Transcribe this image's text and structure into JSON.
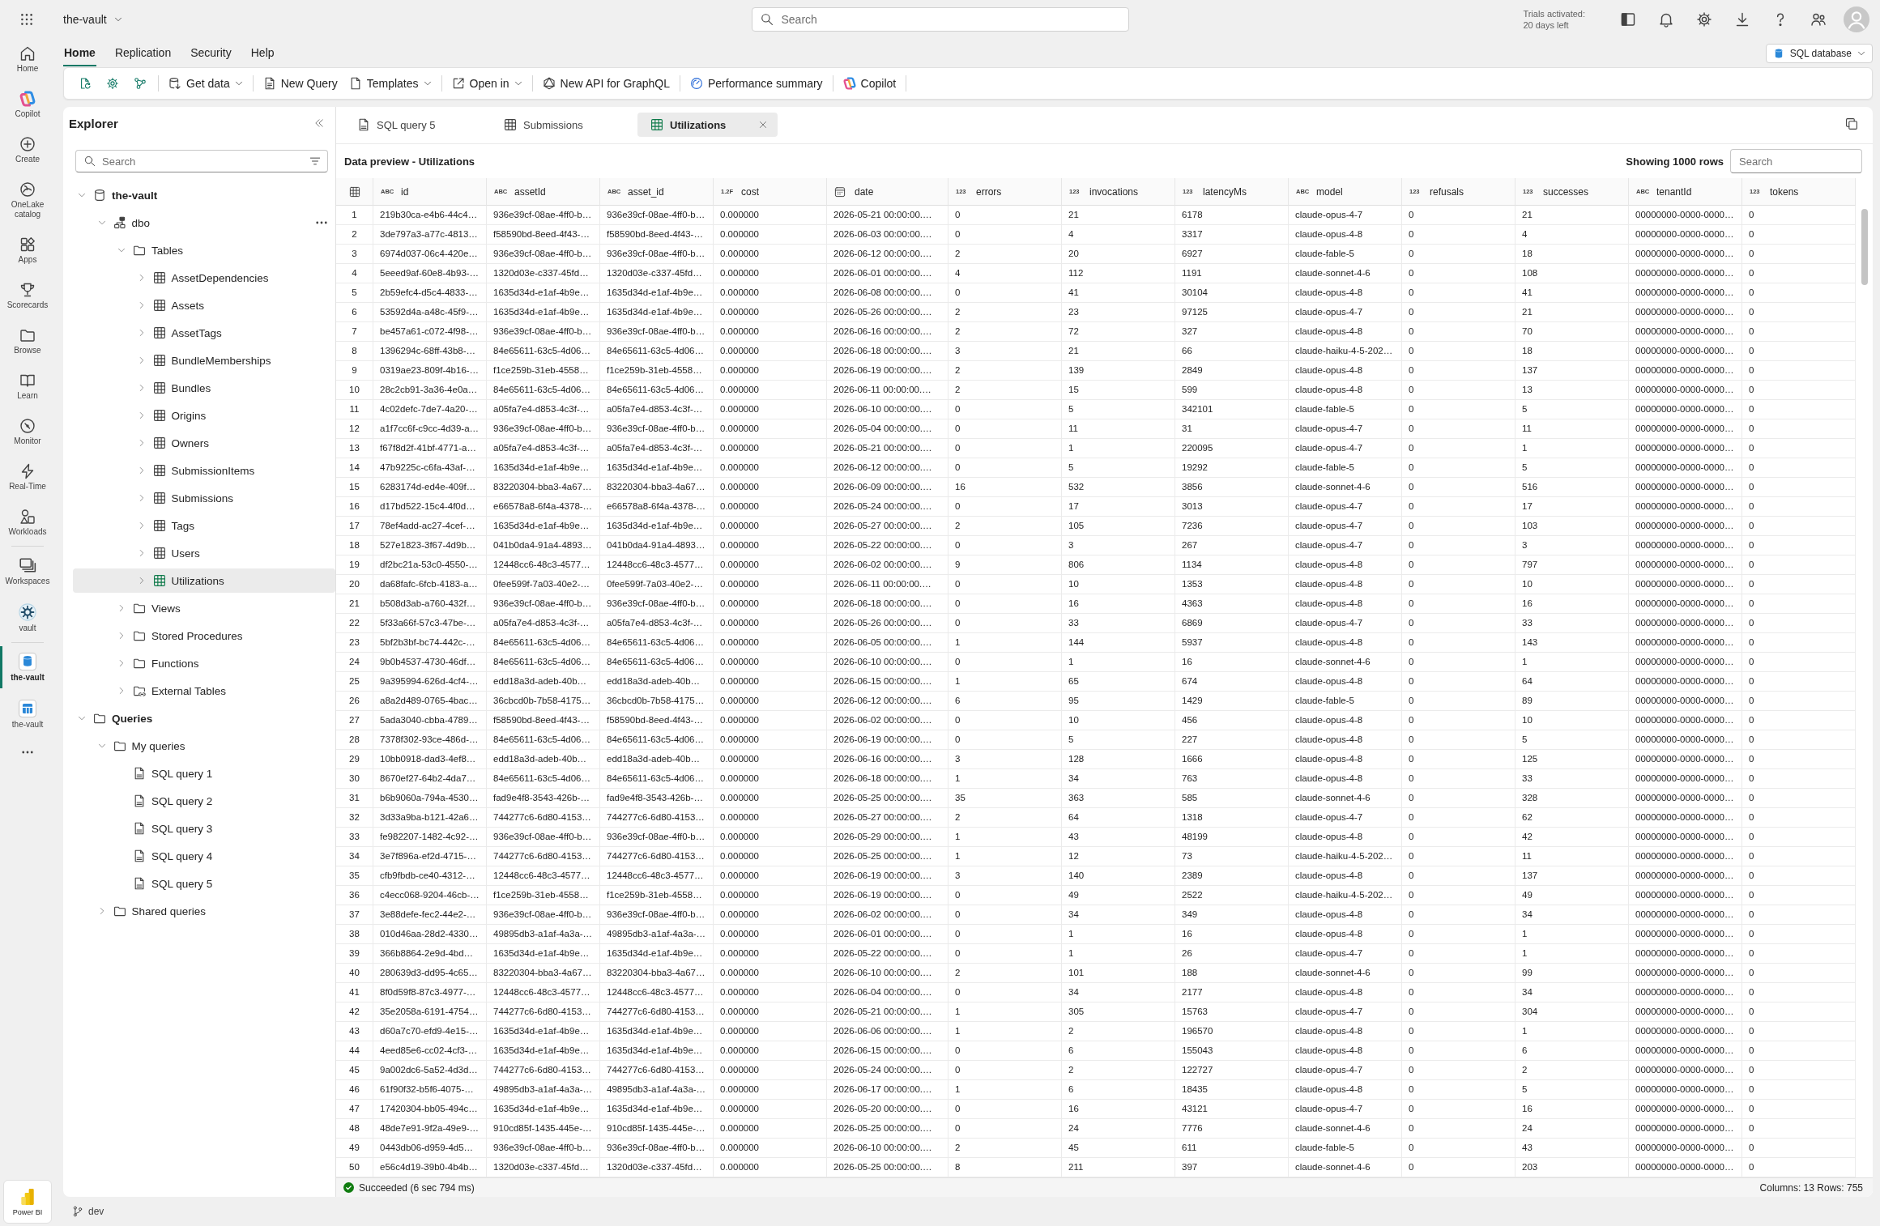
{
  "top_bar": {
    "workspace": "the-vault",
    "search": {
      "placeholder": "Search"
    },
    "trial_notice": [
      "Trials activated:",
      "20 days left"
    ]
  },
  "nav_rail": {
    "groups": [
      [
        {
          "label": "Home",
          "selected": false
        },
        {
          "label": "Copilot",
          "selected": false
        },
        {
          "label": "Create",
          "selected": false
        },
        {
          "label": "OneLake catalog",
          "selected": false
        },
        {
          "label": "Apps",
          "selected": false
        },
        {
          "label": "Scorecards",
          "selected": false
        },
        {
          "label": "Browse",
          "selected": false
        },
        {
          "label": "Learn",
          "selected": false
        },
        {
          "label": "Monitor",
          "selected": false
        },
        {
          "label": "Real-Time",
          "selected": false
        },
        {
          "label": "Workloads",
          "selected": false
        }
      ],
      [
        {
          "label": "Workspaces",
          "selected": false
        },
        {
          "label": "vault",
          "selected": false
        }
      ],
      [
        {
          "label": "the-vault",
          "selected": true
        },
        {
          "label": "the-vault",
          "selected": false
        }
      ]
    ],
    "footer": "Power BI"
  },
  "ribbon": {
    "tabs": [
      {
        "label": "Home",
        "selected": true
      },
      {
        "label": "Replication",
        "selected": false
      },
      {
        "label": "Security",
        "selected": false
      },
      {
        "label": "Help",
        "selected": false
      }
    ],
    "item_type": "SQL database"
  },
  "toolbar": {
    "groups": [
      [
        {
          "label": "Get data",
          "menu": true
        }
      ],
      [
        {
          "label": "New Query",
          "menu": false
        },
        {
          "label": "Templates",
          "menu": true
        }
      ],
      [
        {
          "label": "Open in",
          "menu": true
        }
      ],
      [
        {
          "label": "New API for GraphQL",
          "menu": false
        }
      ],
      [
        {
          "label": "Performance summary",
          "menu": false
        }
      ],
      [
        {
          "label": "Copilot",
          "menu": false
        }
      ]
    ]
  },
  "explorer": {
    "title": "Explorer",
    "search": {
      "placeholder": "Search"
    },
    "tree": [
      {
        "label": "the-vault",
        "kind": "database",
        "expanded": true,
        "selected": false,
        "children": [
          {
            "label": "dbo",
            "kind": "schema",
            "expanded": true,
            "selected": false,
            "children": [
              {
                "label": "Tables",
                "kind": "folder",
                "expanded": true,
                "selected": false,
                "children": [
                  {
                    "label": "AssetDependencies",
                    "kind": "table",
                    "expanded": false,
                    "selected": false
                  },
                  {
                    "label": "Assets",
                    "kind": "table",
                    "expanded": false,
                    "selected": false
                  },
                  {
                    "label": "AssetTags",
                    "kind": "table",
                    "expanded": false,
                    "selected": false
                  },
                  {
                    "label": "BundleMemberships",
                    "kind": "table",
                    "expanded": false,
                    "selected": false
                  },
                  {
                    "label": "Bundles",
                    "kind": "table",
                    "expanded": false,
                    "selected": false
                  },
                  {
                    "label": "Origins",
                    "kind": "table",
                    "expanded": false,
                    "selected": false
                  },
                  {
                    "label": "Owners",
                    "kind": "table",
                    "expanded": false,
                    "selected": false
                  },
                  {
                    "label": "SubmissionItems",
                    "kind": "table",
                    "expanded": false,
                    "selected": false
                  },
                  {
                    "label": "Submissions",
                    "kind": "table",
                    "expanded": false,
                    "selected": false
                  },
                  {
                    "label": "Tags",
                    "kind": "table",
                    "expanded": false,
                    "selected": false
                  },
                  {
                    "label": "Users",
                    "kind": "table",
                    "expanded": false,
                    "selected": false
                  },
                  {
                    "label": "Utilizations",
                    "kind": "table",
                    "expanded": false,
                    "selected": true
                  }
                ]
              },
              {
                "label": "Views",
                "kind": "folder",
                "expanded": false,
                "selected": false
              },
              {
                "label": "Stored Procedures",
                "kind": "folder",
                "expanded": false,
                "selected": false
              },
              {
                "label": "Functions",
                "kind": "folder",
                "expanded": false,
                "selected": false
              },
              {
                "label": "External Tables",
                "kind": "external",
                "expanded": false,
                "selected": false
              }
            ]
          }
        ]
      },
      {
        "label": "Queries",
        "kind": "folder",
        "expanded": true,
        "selected": false,
        "children": [
          {
            "label": "My queries",
            "kind": "folder",
            "expanded": true,
            "selected": false,
            "children": [
              {
                "label": "SQL query 1",
                "kind": "query",
                "selected": false
              },
              {
                "label": "SQL query 2",
                "kind": "query",
                "selected": false
              },
              {
                "label": "SQL query 3",
                "kind": "query",
                "selected": false
              },
              {
                "label": "SQL query 4",
                "kind": "query",
                "selected": false
              },
              {
                "label": "SQL query 5",
                "kind": "query",
                "selected": false
              }
            ]
          },
          {
            "label": "Shared queries",
            "kind": "folder",
            "expanded": false,
            "selected": false
          }
        ]
      }
    ]
  },
  "editor": {
    "tabs": [
      {
        "label": "SQL query 5",
        "kind": "query",
        "selected": false
      },
      {
        "label": "Submissions",
        "kind": "table",
        "selected": false
      },
      {
        "label": "Utilizations",
        "kind": "table",
        "selected": true
      }
    ],
    "preview_title": "Data preview - Utilizations",
    "row_limit": "Showing 1000 rows",
    "search": {
      "placeholder": "Search"
    },
    "table": {
      "columns": [
        {
          "kind": "index"
        },
        {
          "name": "id",
          "kind": "badge",
          "badge": "ABC"
        },
        {
          "name": "assetId",
          "kind": "badge",
          "badge": "ABC"
        },
        {
          "name": "asset_id",
          "kind": "badge",
          "badge": "ABC"
        },
        {
          "name": "cost",
          "kind": "badge",
          "badge": "1.2F"
        },
        {
          "name": "date",
          "kind": "date"
        },
        {
          "name": "errors",
          "kind": "badge",
          "badge": "123"
        },
        {
          "name": "invocations",
          "kind": "badge",
          "badge": "123"
        },
        {
          "name": "latencyMs",
          "kind": "badge",
          "badge": "123"
        },
        {
          "name": "model",
          "kind": "badge",
          "badge": "ABC"
        },
        {
          "name": "refusals",
          "kind": "badge",
          "badge": "123"
        },
        {
          "name": "successes",
          "kind": "badge",
          "badge": "123"
        },
        {
          "name": "tenantId",
          "kind": "badge",
          "badge": "ABC"
        },
        {
          "name": "tokens",
          "kind": "badge",
          "badge": "123"
        }
      ],
      "rows": [
        [
          "1",
          "219b30ca-e4b6-44c4…",
          "936e39cf-08ae-4ff0-b…",
          "936e39cf-08ae-4ff0-b…",
          "0.000000",
          "2026-05-21 00:00:00.…",
          "0",
          "21",
          "6178",
          "claude-opus-4-7",
          "0",
          "21",
          "00000000-0000-0000…",
          "0"
        ],
        [
          "2",
          "3de797a3-a77c-4813…",
          "f58590bd-8eed-4f43-…",
          "f58590bd-8eed-4f43-…",
          "0.000000",
          "2026-06-03 00:00:00.…",
          "0",
          "4",
          "3317",
          "claude-opus-4-8",
          "0",
          "4",
          "00000000-0000-0000…",
          "0"
        ],
        [
          "3",
          "6974d037-06c4-420e…",
          "936e39cf-08ae-4ff0-b…",
          "936e39cf-08ae-4ff0-b…",
          "0.000000",
          "2026-06-12 00:00:00.…",
          "2",
          "20",
          "6927",
          "claude-fable-5",
          "0",
          "18",
          "00000000-0000-0000…",
          "0"
        ],
        [
          "4",
          "5eeed9af-60e8-4b93-…",
          "1320d03e-c337-45fd…",
          "1320d03e-c337-45fd…",
          "0.000000",
          "2026-06-01 00:00:00.…",
          "4",
          "112",
          "1191",
          "claude-sonnet-4-6",
          "0",
          "108",
          "00000000-0000-0000…",
          "0"
        ],
        [
          "5",
          "2b59efc4-d5c4-4833-…",
          "1635d34d-e1af-4b9e…",
          "1635d34d-e1af-4b9e…",
          "0.000000",
          "2026-06-08 00:00:00.…",
          "0",
          "41",
          "30104",
          "claude-opus-4-8",
          "0",
          "41",
          "00000000-0000-0000…",
          "0"
        ],
        [
          "6",
          "53592d4a-a48c-45f9-…",
          "1635d34d-e1af-4b9e…",
          "1635d34d-e1af-4b9e…",
          "0.000000",
          "2026-05-26 00:00:00.…",
          "2",
          "23",
          "97125",
          "claude-opus-4-7",
          "0",
          "21",
          "00000000-0000-0000…",
          "0"
        ],
        [
          "7",
          "be457a61-c072-4f98-…",
          "936e39cf-08ae-4ff0-b…",
          "936e39cf-08ae-4ff0-b…",
          "0.000000",
          "2026-06-16 00:00:00.…",
          "2",
          "72",
          "327",
          "claude-opus-4-8",
          "0",
          "70",
          "00000000-0000-0000…",
          "0"
        ],
        [
          "8",
          "1396294c-68ff-43b8-…",
          "84e65611-63c5-4d06…",
          "84e65611-63c5-4d06…",
          "0.000000",
          "2026-06-18 00:00:00.…",
          "3",
          "21",
          "66",
          "claude-haiku-4-5-202…",
          "0",
          "18",
          "00000000-0000-0000…",
          "0"
        ],
        [
          "9",
          "0319ae23-809f-4b16-…",
          "f1ce259b-31eb-4558…",
          "f1ce259b-31eb-4558…",
          "0.000000",
          "2026-06-19 00:00:00.…",
          "2",
          "139",
          "2849",
          "claude-opus-4-8",
          "0",
          "137",
          "00000000-0000-0000…",
          "0"
        ],
        [
          "10",
          "28c2cb91-3a36-4e0a…",
          "84e65611-63c5-4d06…",
          "84e65611-63c5-4d06…",
          "0.000000",
          "2026-06-11 00:00:00.…",
          "2",
          "15",
          "599",
          "claude-opus-4-8",
          "0",
          "13",
          "00000000-0000-0000…",
          "0"
        ],
        [
          "11",
          "4c02defc-7de7-4a20-…",
          "a05fa7e4-d853-4c3f-…",
          "a05fa7e4-d853-4c3f-…",
          "0.000000",
          "2026-06-10 00:00:00.…",
          "0",
          "5",
          "342101",
          "claude-fable-5",
          "0",
          "5",
          "00000000-0000-0000…",
          "0"
        ],
        [
          "12",
          "a1f7cc6f-c9cc-4d39-a…",
          "936e39cf-08ae-4ff0-b…",
          "936e39cf-08ae-4ff0-b…",
          "0.000000",
          "2026-05-04 00:00:00.…",
          "0",
          "11",
          "31",
          "claude-opus-4-7",
          "0",
          "11",
          "00000000-0000-0000…",
          "0"
        ],
        [
          "13",
          "f67f8d2f-41bf-4771-a…",
          "a05fa7e4-d853-4c3f-…",
          "a05fa7e4-d853-4c3f-…",
          "0.000000",
          "2026-05-21 00:00:00.…",
          "0",
          "1",
          "220095",
          "claude-opus-4-7",
          "0",
          "1",
          "00000000-0000-0000…",
          "0"
        ],
        [
          "14",
          "47b9225c-c6fa-43af-…",
          "1635d34d-e1af-4b9e…",
          "1635d34d-e1af-4b9e…",
          "0.000000",
          "2026-06-12 00:00:00.…",
          "0",
          "5",
          "19292",
          "claude-fable-5",
          "0",
          "5",
          "00000000-0000-0000…",
          "0"
        ],
        [
          "15",
          "6283174d-ed4e-409f…",
          "83220304-bba3-4a67…",
          "83220304-bba3-4a67…",
          "0.000000",
          "2026-06-09 00:00:00.…",
          "16",
          "532",
          "3856",
          "claude-sonnet-4-6",
          "0",
          "516",
          "00000000-0000-0000…",
          "0"
        ],
        [
          "16",
          "d17bd522-15c4-4f0d…",
          "e66578a8-6f4a-4378-…",
          "e66578a8-6f4a-4378-…",
          "0.000000",
          "2026-05-24 00:00:00.…",
          "0",
          "17",
          "3013",
          "claude-opus-4-7",
          "0",
          "17",
          "00000000-0000-0000…",
          "0"
        ],
        [
          "17",
          "78ef4add-ac27-4cef-…",
          "1635d34d-e1af-4b9e…",
          "1635d34d-e1af-4b9e…",
          "0.000000",
          "2026-05-27 00:00:00.…",
          "2",
          "105",
          "7236",
          "claude-opus-4-7",
          "0",
          "103",
          "00000000-0000-0000…",
          "0"
        ],
        [
          "18",
          "527e1823-3f67-4d9b…",
          "041b0da4-91a4-4893…",
          "041b0da4-91a4-4893…",
          "0.000000",
          "2026-05-22 00:00:00.…",
          "0",
          "3",
          "267",
          "claude-opus-4-7",
          "0",
          "3",
          "00000000-0000-0000…",
          "0"
        ],
        [
          "19",
          "df2bc21a-53c0-4550-…",
          "12448cc6-48c3-4577…",
          "12448cc6-48c3-4577…",
          "0.000000",
          "2026-06-02 00:00:00.…",
          "9",
          "806",
          "1134",
          "claude-opus-4-8",
          "0",
          "797",
          "00000000-0000-0000…",
          "0"
        ],
        [
          "20",
          "da68fafc-6fcb-4183-a…",
          "0fee599f-7a03-40e2-…",
          "0fee599f-7a03-40e2-…",
          "0.000000",
          "2026-06-11 00:00:00.…",
          "0",
          "10",
          "1353",
          "claude-opus-4-8",
          "0",
          "10",
          "00000000-0000-0000…",
          "0"
        ],
        [
          "21",
          "b508d3ab-a760-432f…",
          "936e39cf-08ae-4ff0-b…",
          "936e39cf-08ae-4ff0-b…",
          "0.000000",
          "2026-06-18 00:00:00.…",
          "0",
          "16",
          "4363",
          "claude-opus-4-8",
          "0",
          "16",
          "00000000-0000-0000…",
          "0"
        ],
        [
          "22",
          "5f33a66f-57c3-47be-…",
          "a05fa7e4-d853-4c3f-…",
          "a05fa7e4-d853-4c3f-…",
          "0.000000",
          "2026-05-26 00:00:00.…",
          "0",
          "33",
          "6869",
          "claude-opus-4-7",
          "0",
          "33",
          "00000000-0000-0000…",
          "0"
        ],
        [
          "23",
          "5bf2b3bf-bc74-442c-…",
          "84e65611-63c5-4d06…",
          "84e65611-63c5-4d06…",
          "0.000000",
          "2026-06-05 00:00:00.…",
          "1",
          "144",
          "5937",
          "claude-opus-4-8",
          "0",
          "143",
          "00000000-0000-0000…",
          "0"
        ],
        [
          "24",
          "9b0b4537-4730-46df…",
          "84e65611-63c5-4d06…",
          "84e65611-63c5-4d06…",
          "0.000000",
          "2026-06-10 00:00:00.…",
          "0",
          "1",
          "16",
          "claude-sonnet-4-6",
          "0",
          "1",
          "00000000-0000-0000…",
          "0"
        ],
        [
          "25",
          "9a395994-626d-4cf4-…",
          "edd18a3d-adeb-40b…",
          "edd18a3d-adeb-40b…",
          "0.000000",
          "2026-06-15 00:00:00.…",
          "1",
          "65",
          "674",
          "claude-opus-4-8",
          "0",
          "64",
          "00000000-0000-0000…",
          "0"
        ],
        [
          "26",
          "a8a2d489-0765-4bac…",
          "36cbcd0b-7b58-4175…",
          "36cbcd0b-7b58-4175…",
          "0.000000",
          "2026-06-12 00:00:00.…",
          "6",
          "95",
          "1429",
          "claude-fable-5",
          "0",
          "89",
          "00000000-0000-0000…",
          "0"
        ],
        [
          "27",
          "5ada3040-cbba-4789…",
          "f58590bd-8eed-4f43-…",
          "f58590bd-8eed-4f43-…",
          "0.000000",
          "2026-06-02 00:00:00.…",
          "0",
          "10",
          "456",
          "claude-opus-4-8",
          "0",
          "10",
          "00000000-0000-0000…",
          "0"
        ],
        [
          "28",
          "7378f302-93ce-486d-…",
          "84e65611-63c5-4d06…",
          "84e65611-63c5-4d06…",
          "0.000000",
          "2026-06-19 00:00:00.…",
          "0",
          "5",
          "227",
          "claude-opus-4-8",
          "0",
          "5",
          "00000000-0000-0000…",
          "0"
        ],
        [
          "29",
          "10bb0918-dad3-4ef8…",
          "edd18a3d-adeb-40b…",
          "edd18a3d-adeb-40b…",
          "0.000000",
          "2026-06-16 00:00:00.…",
          "3",
          "128",
          "1666",
          "claude-opus-4-8",
          "0",
          "125",
          "00000000-0000-0000…",
          "0"
        ],
        [
          "30",
          "8670ef27-64b2-4da7…",
          "84e65611-63c5-4d06…",
          "84e65611-63c5-4d06…",
          "0.000000",
          "2026-06-18 00:00:00.…",
          "1",
          "34",
          "763",
          "claude-opus-4-8",
          "0",
          "33",
          "00000000-0000-0000…",
          "0"
        ],
        [
          "31",
          "b6b9060a-794a-4530…",
          "fad9e4f8-3543-426b-…",
          "fad9e4f8-3543-426b-…",
          "0.000000",
          "2026-05-25 00:00:00.…",
          "35",
          "363",
          "585",
          "claude-sonnet-4-6",
          "0",
          "328",
          "00000000-0000-0000…",
          "0"
        ],
        [
          "32",
          "3d33a9ba-b121-42a6…",
          "744277c6-6d80-4153…",
          "744277c6-6d80-4153…",
          "0.000000",
          "2026-05-27 00:00:00.…",
          "2",
          "64",
          "1318",
          "claude-opus-4-7",
          "0",
          "62",
          "00000000-0000-0000…",
          "0"
        ],
        [
          "33",
          "fe982207-1482-4c92-…",
          "936e39cf-08ae-4ff0-b…",
          "936e39cf-08ae-4ff0-b…",
          "0.000000",
          "2026-05-29 00:00:00.…",
          "1",
          "43",
          "48199",
          "claude-opus-4-8",
          "0",
          "42",
          "00000000-0000-0000…",
          "0"
        ],
        [
          "34",
          "3e7f896a-ef2d-4715-…",
          "744277c6-6d80-4153…",
          "744277c6-6d80-4153…",
          "0.000000",
          "2026-05-25 00:00:00.…",
          "1",
          "12",
          "73",
          "claude-haiku-4-5-202…",
          "0",
          "11",
          "00000000-0000-0000…",
          "0"
        ],
        [
          "35",
          "cfb9fbdb-ce40-4312-…",
          "12448cc6-48c3-4577…",
          "12448cc6-48c3-4577…",
          "0.000000",
          "2026-06-19 00:00:00.…",
          "3",
          "140",
          "2389",
          "claude-opus-4-8",
          "0",
          "137",
          "00000000-0000-0000…",
          "0"
        ],
        [
          "36",
          "c4ecc068-9204-46cb-…",
          "f1ce259b-31eb-4558…",
          "f1ce259b-31eb-4558…",
          "0.000000",
          "2026-06-19 00:00:00.…",
          "0",
          "49",
          "2522",
          "claude-haiku-4-5-202…",
          "0",
          "49",
          "00000000-0000-0000…",
          "0"
        ],
        [
          "37",
          "3e88defe-fec2-44e2-…",
          "936e39cf-08ae-4ff0-b…",
          "936e39cf-08ae-4ff0-b…",
          "0.000000",
          "2026-06-02 00:00:00.…",
          "0",
          "34",
          "349",
          "claude-opus-4-8",
          "0",
          "34",
          "00000000-0000-0000…",
          "0"
        ],
        [
          "38",
          "010d46aa-28d2-4330…",
          "49895db3-a1af-4a3a-…",
          "49895db3-a1af-4a3a-…",
          "0.000000",
          "2026-06-01 00:00:00.…",
          "0",
          "1",
          "16",
          "claude-opus-4-8",
          "0",
          "1",
          "00000000-0000-0000…",
          "0"
        ],
        [
          "39",
          "366b8864-2e9d-4bd…",
          "1635d34d-e1af-4b9e…",
          "1635d34d-e1af-4b9e…",
          "0.000000",
          "2026-05-22 00:00:00.…",
          "0",
          "1",
          "26",
          "claude-opus-4-7",
          "0",
          "1",
          "00000000-0000-0000…",
          "0"
        ],
        [
          "40",
          "280639d3-dd95-4c65…",
          "83220304-bba3-4a67…",
          "83220304-bba3-4a67…",
          "0.000000",
          "2026-06-10 00:00:00.…",
          "2",
          "101",
          "188",
          "claude-sonnet-4-6",
          "0",
          "99",
          "00000000-0000-0000…",
          "0"
        ],
        [
          "41",
          "8f0d59f8-87c3-4977-…",
          "12448cc6-48c3-4577…",
          "12448cc6-48c3-4577…",
          "0.000000",
          "2026-06-04 00:00:00.…",
          "0",
          "34",
          "2177",
          "claude-opus-4-8",
          "0",
          "34",
          "00000000-0000-0000…",
          "0"
        ],
        [
          "42",
          "35e2058a-6191-4754…",
          "744277c6-6d80-4153…",
          "744277c6-6d80-4153…",
          "0.000000",
          "2026-05-21 00:00:00.…",
          "1",
          "305",
          "15763",
          "claude-opus-4-7",
          "0",
          "304",
          "00000000-0000-0000…",
          "0"
        ],
        [
          "43",
          "d60a7c70-efd9-4e15-…",
          "1635d34d-e1af-4b9e…",
          "1635d34d-e1af-4b9e…",
          "0.000000",
          "2026-06-06 00:00:00.…",
          "1",
          "2",
          "196570",
          "claude-opus-4-8",
          "0",
          "1",
          "00000000-0000-0000…",
          "0"
        ],
        [
          "44",
          "4eed85e6-cc02-4cf3-…",
          "1635d34d-e1af-4b9e…",
          "1635d34d-e1af-4b9e…",
          "0.000000",
          "2026-06-15 00:00:00.…",
          "0",
          "6",
          "155043",
          "claude-opus-4-8",
          "0",
          "6",
          "00000000-0000-0000…",
          "0"
        ],
        [
          "45",
          "9a002dc6-5a52-4d3d…",
          "744277c6-6d80-4153…",
          "744277c6-6d80-4153…",
          "0.000000",
          "2026-05-24 00:00:00.…",
          "0",
          "2",
          "122727",
          "claude-opus-4-7",
          "0",
          "2",
          "00000000-0000-0000…",
          "0"
        ],
        [
          "46",
          "61f90f32-b5f6-4075-…",
          "49895db3-a1af-4a3a-…",
          "49895db3-a1af-4a3a-…",
          "0.000000",
          "2026-06-17 00:00:00.…",
          "1",
          "6",
          "18435",
          "claude-opus-4-8",
          "0",
          "5",
          "00000000-0000-0000…",
          "0"
        ],
        [
          "47",
          "17420304-bb05-494c…",
          "1635d34d-e1af-4b9e…",
          "1635d34d-e1af-4b9e…",
          "0.000000",
          "2026-05-20 00:00:00.…",
          "0",
          "16",
          "43121",
          "claude-opus-4-7",
          "0",
          "16",
          "00000000-0000-0000…",
          "0"
        ],
        [
          "48",
          "48de7e91-9f2a-49e9-…",
          "910cd85f-1435-445e-…",
          "910cd85f-1435-445e-…",
          "0.000000",
          "2026-05-25 00:00:00.…",
          "0",
          "24",
          "7776",
          "claude-sonnet-4-6",
          "0",
          "24",
          "00000000-0000-0000…",
          "0"
        ],
        [
          "49",
          "0443db06-d959-4d5…",
          "936e39cf-08ae-4ff0-b…",
          "936e39cf-08ae-4ff0-b…",
          "0.000000",
          "2026-06-10 00:00:00.…",
          "2",
          "45",
          "611",
          "claude-fable-5",
          "0",
          "43",
          "00000000-0000-0000…",
          "0"
        ],
        [
          "50",
          "e56c4d19-39b0-4b4b…",
          "1320d03e-c337-45fd…",
          "1320d03e-c337-45fd…",
          "0.000000",
          "2026-05-25 00:00:00.…",
          "8",
          "211",
          "397",
          "claude-sonnet-4-6",
          "0",
          "203",
          "00000000-0000-0000…",
          "0"
        ]
      ]
    },
    "status": {
      "kind": "success",
      "message": "Succeeded (6 sec 794 ms)",
      "summary": "Columns: 13 Rows: 755"
    }
  },
  "bottom_bar": {
    "branch": "dev"
  }
}
